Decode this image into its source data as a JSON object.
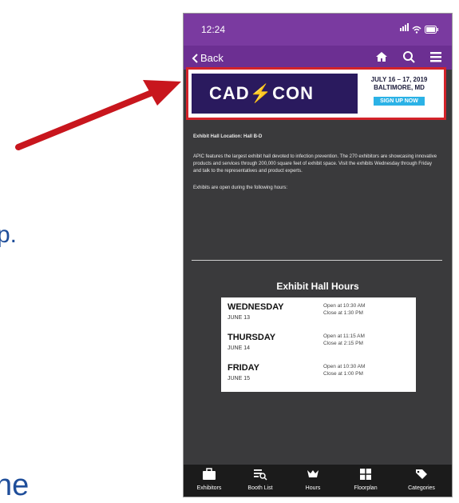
{
  "slide": {
    "fragment_1": "p.",
    "fragment_2": "he"
  },
  "status": {
    "time": "12:24"
  },
  "nav": {
    "back_label": "Back",
    "icons": [
      "home-icon",
      "search-icon",
      "menu-icon"
    ]
  },
  "banner": {
    "logo_left": "CAD",
    "logo_right": "CON",
    "date": "JULY 16 – 17, 2019",
    "city": "BALTIMORE, MD",
    "cta": "SIGN UP NOW"
  },
  "content": {
    "location": "Exhibit Hall Location: Hall B-D",
    "paragraph": "APIC features the largest exhibit hall devoted to infection prevention. The 270 exhibitors are showcasing innovative products and services through 200,000 square feet of exhibit space. Visit the exhibits Wednesday through Friday and talk to the representatives and product experts.",
    "hours_note": "Exhibits are open during the following hours:"
  },
  "hours": {
    "title": "Exhibit Hall Hours",
    "rows": [
      {
        "day": "WEDNESDAY",
        "date": "JUNE 13",
        "open": "Open at 10:30 AM",
        "close": "Close at 1:30 PM"
      },
      {
        "day": "THURSDAY",
        "date": "JUNE 14",
        "open": "Open at 11:15 AM",
        "close": "Close at 2:15 PM"
      },
      {
        "day": "FRIDAY",
        "date": "JUNE 15",
        "open": "Open at 10:30 AM",
        "close": "Close at 1:00 PM"
      }
    ]
  },
  "tabs": [
    {
      "label": "Exhibitors",
      "icon": "briefcase-icon"
    },
    {
      "label": "Booth List",
      "icon": "list-search-icon"
    },
    {
      "label": "Hours",
      "icon": "clock-icon"
    },
    {
      "label": "Floorplan",
      "icon": "map-icon"
    },
    {
      "label": "Categories",
      "icon": "tag-icon"
    }
  ],
  "colors": {
    "status_bar": "#7a3aa0",
    "nav_bar": "#6c2f92",
    "highlight": "#d3232a",
    "arrow": "#c8161d",
    "cta": "#2bb2e6"
  }
}
